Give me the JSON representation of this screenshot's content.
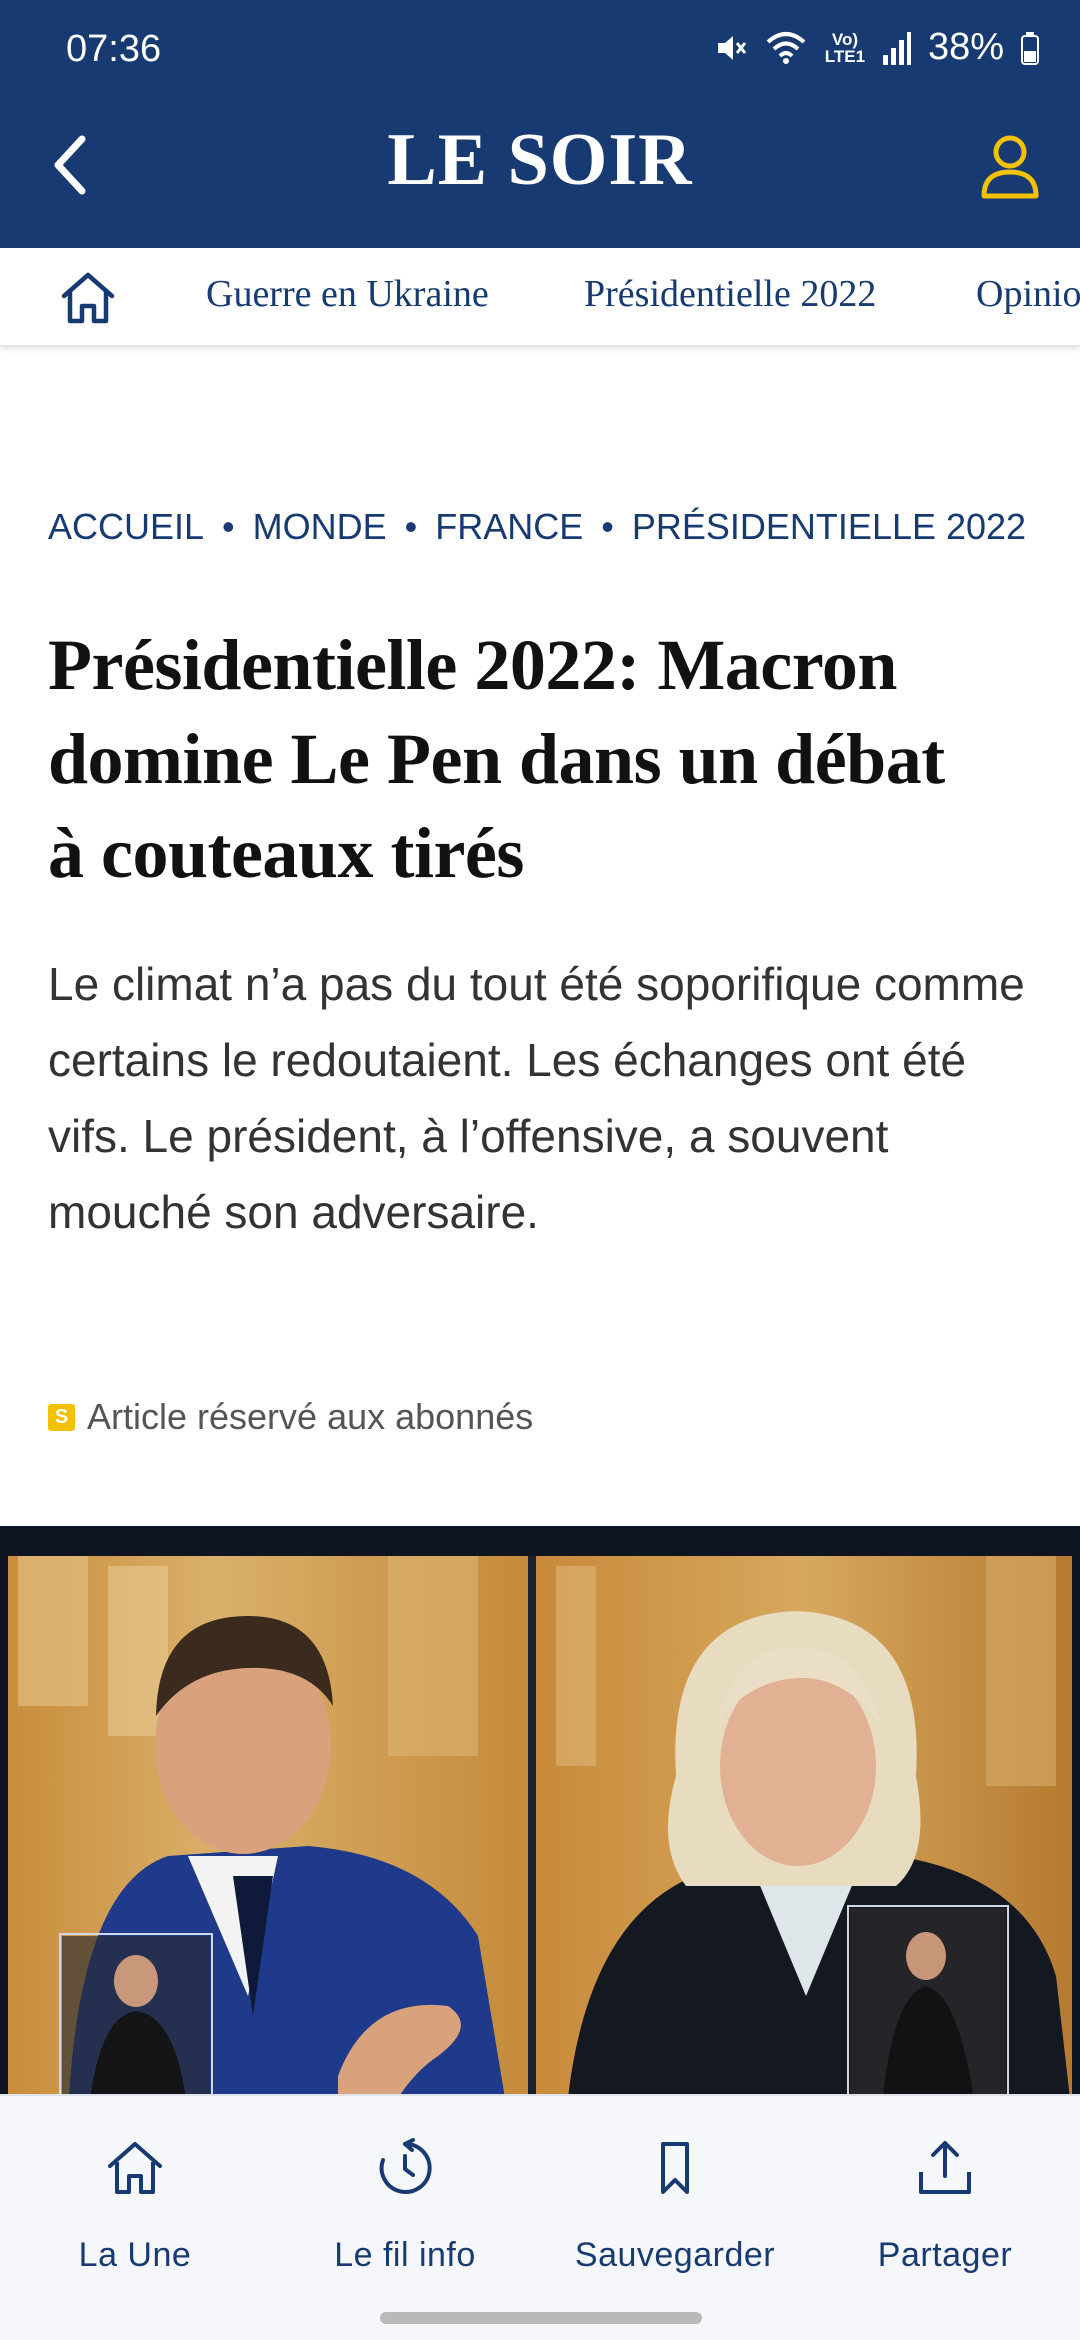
{
  "status_bar": {
    "time": "07:36",
    "battery": "38%",
    "network_label": "Vo) LTE1",
    "icons": [
      "mute-icon",
      "wifi-icon",
      "lte-icon",
      "signal-icon",
      "battery-icon"
    ]
  },
  "header": {
    "brand": "LE SOIR",
    "background_color": "#173a72",
    "accent_color": "#f2c200",
    "back_icon": "chevron-left-icon",
    "user_icon": "user-icon"
  },
  "category_nav": {
    "home_icon": "home-icon",
    "items": [
      "Guerre en Ukraine",
      "Présidentielle 2022",
      "Opinio"
    ]
  },
  "article": {
    "breadcrumb": [
      "ACCUEIL",
      "MONDE",
      "FRANCE",
      "PRÉSIDENTIELLE 2022"
    ],
    "headline_lines": [
      "Présidentielle 2022: Macron",
      "domine Le Pen dans un débat",
      "à couteaux tirés"
    ],
    "lead": "Le climat n’a pas du tout été soporifique comme certains le redoutaient. Les échanges ont été vifs. Le président, à l’offensive, a souvent mouché son adversaire.",
    "subscriber_badge": "S",
    "subscriber_label": "Article réservé aux abonnés"
  },
  "bottom_nav": {
    "items": [
      {
        "label": "La Une",
        "icon": "home-icon"
      },
      {
        "label": "Le fil info",
        "icon": "history-icon"
      },
      {
        "label": "Sauvegarder",
        "icon": "bookmark-icon"
      },
      {
        "label": "Partager",
        "icon": "share-icon"
      }
    ]
  }
}
